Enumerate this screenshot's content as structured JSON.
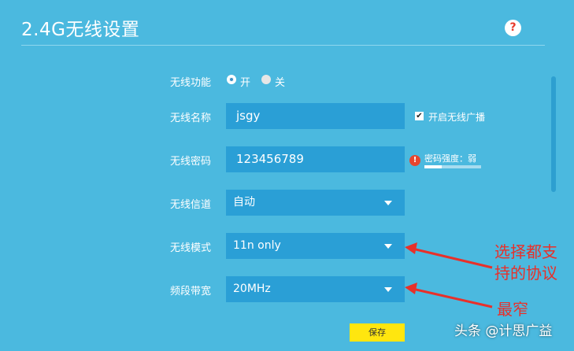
{
  "page": {
    "title": "2.4G无线设置",
    "help": "?"
  },
  "wireless_function": {
    "label": "无线功能",
    "options": [
      {
        "label": "开",
        "selected": true
      },
      {
        "label": "关",
        "selected": false
      }
    ]
  },
  "ssid": {
    "label": "无线名称",
    "value": "jsgy",
    "broadcast_label": "开启无线广播",
    "broadcast_checked": true
  },
  "password": {
    "label": "无线密码",
    "value": "123456789",
    "strength_label": "密码强度：弱",
    "strength_level": 0.3
  },
  "channel": {
    "label": "无线信道",
    "value": "自动"
  },
  "mode": {
    "label": "无线模式",
    "value": "11n only"
  },
  "bandwidth": {
    "label": "频段带宽",
    "value": "20MHz"
  },
  "save_button": "保存",
  "annotations": {
    "protocol_line1": "选择都支",
    "protocol_line2": "持的协议",
    "bandwidth_note": "最窄"
  },
  "watermark": "头条 @计思广益",
  "colors": {
    "background": "#4bb9df",
    "input": "#2a9fd6",
    "save": "#ffe60f",
    "annotation": "#e8302a"
  }
}
